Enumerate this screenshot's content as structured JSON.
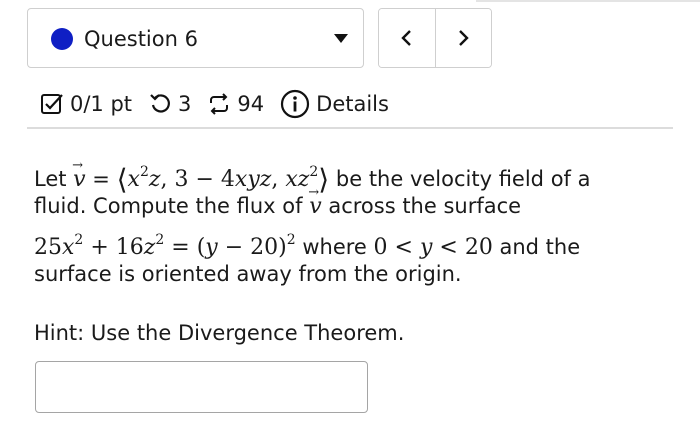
{
  "question_selector": {
    "label": "Question 6",
    "status_color": "#0f1fc4",
    "caret_icon": "caret-down-icon"
  },
  "nav": {
    "prev_label": "<",
    "next_label": ">"
  },
  "meta": {
    "points": "0/1 pt",
    "attempts": "3",
    "submissions": "94",
    "details_label": "Details"
  },
  "problem": {
    "let_text": "Let",
    "eq_sign": "=",
    "velocity_text": "be the velocity field of a",
    "line2": "fluid. Compute the flux of",
    "line2_end": "across the surface",
    "line3_end": "where",
    "line3_and": "and the",
    "line4": "surface is oriented away from the origin."
  },
  "hint": "Hint: Use the Divergence Theorem.",
  "answer": {
    "value": "",
    "placeholder": ""
  }
}
